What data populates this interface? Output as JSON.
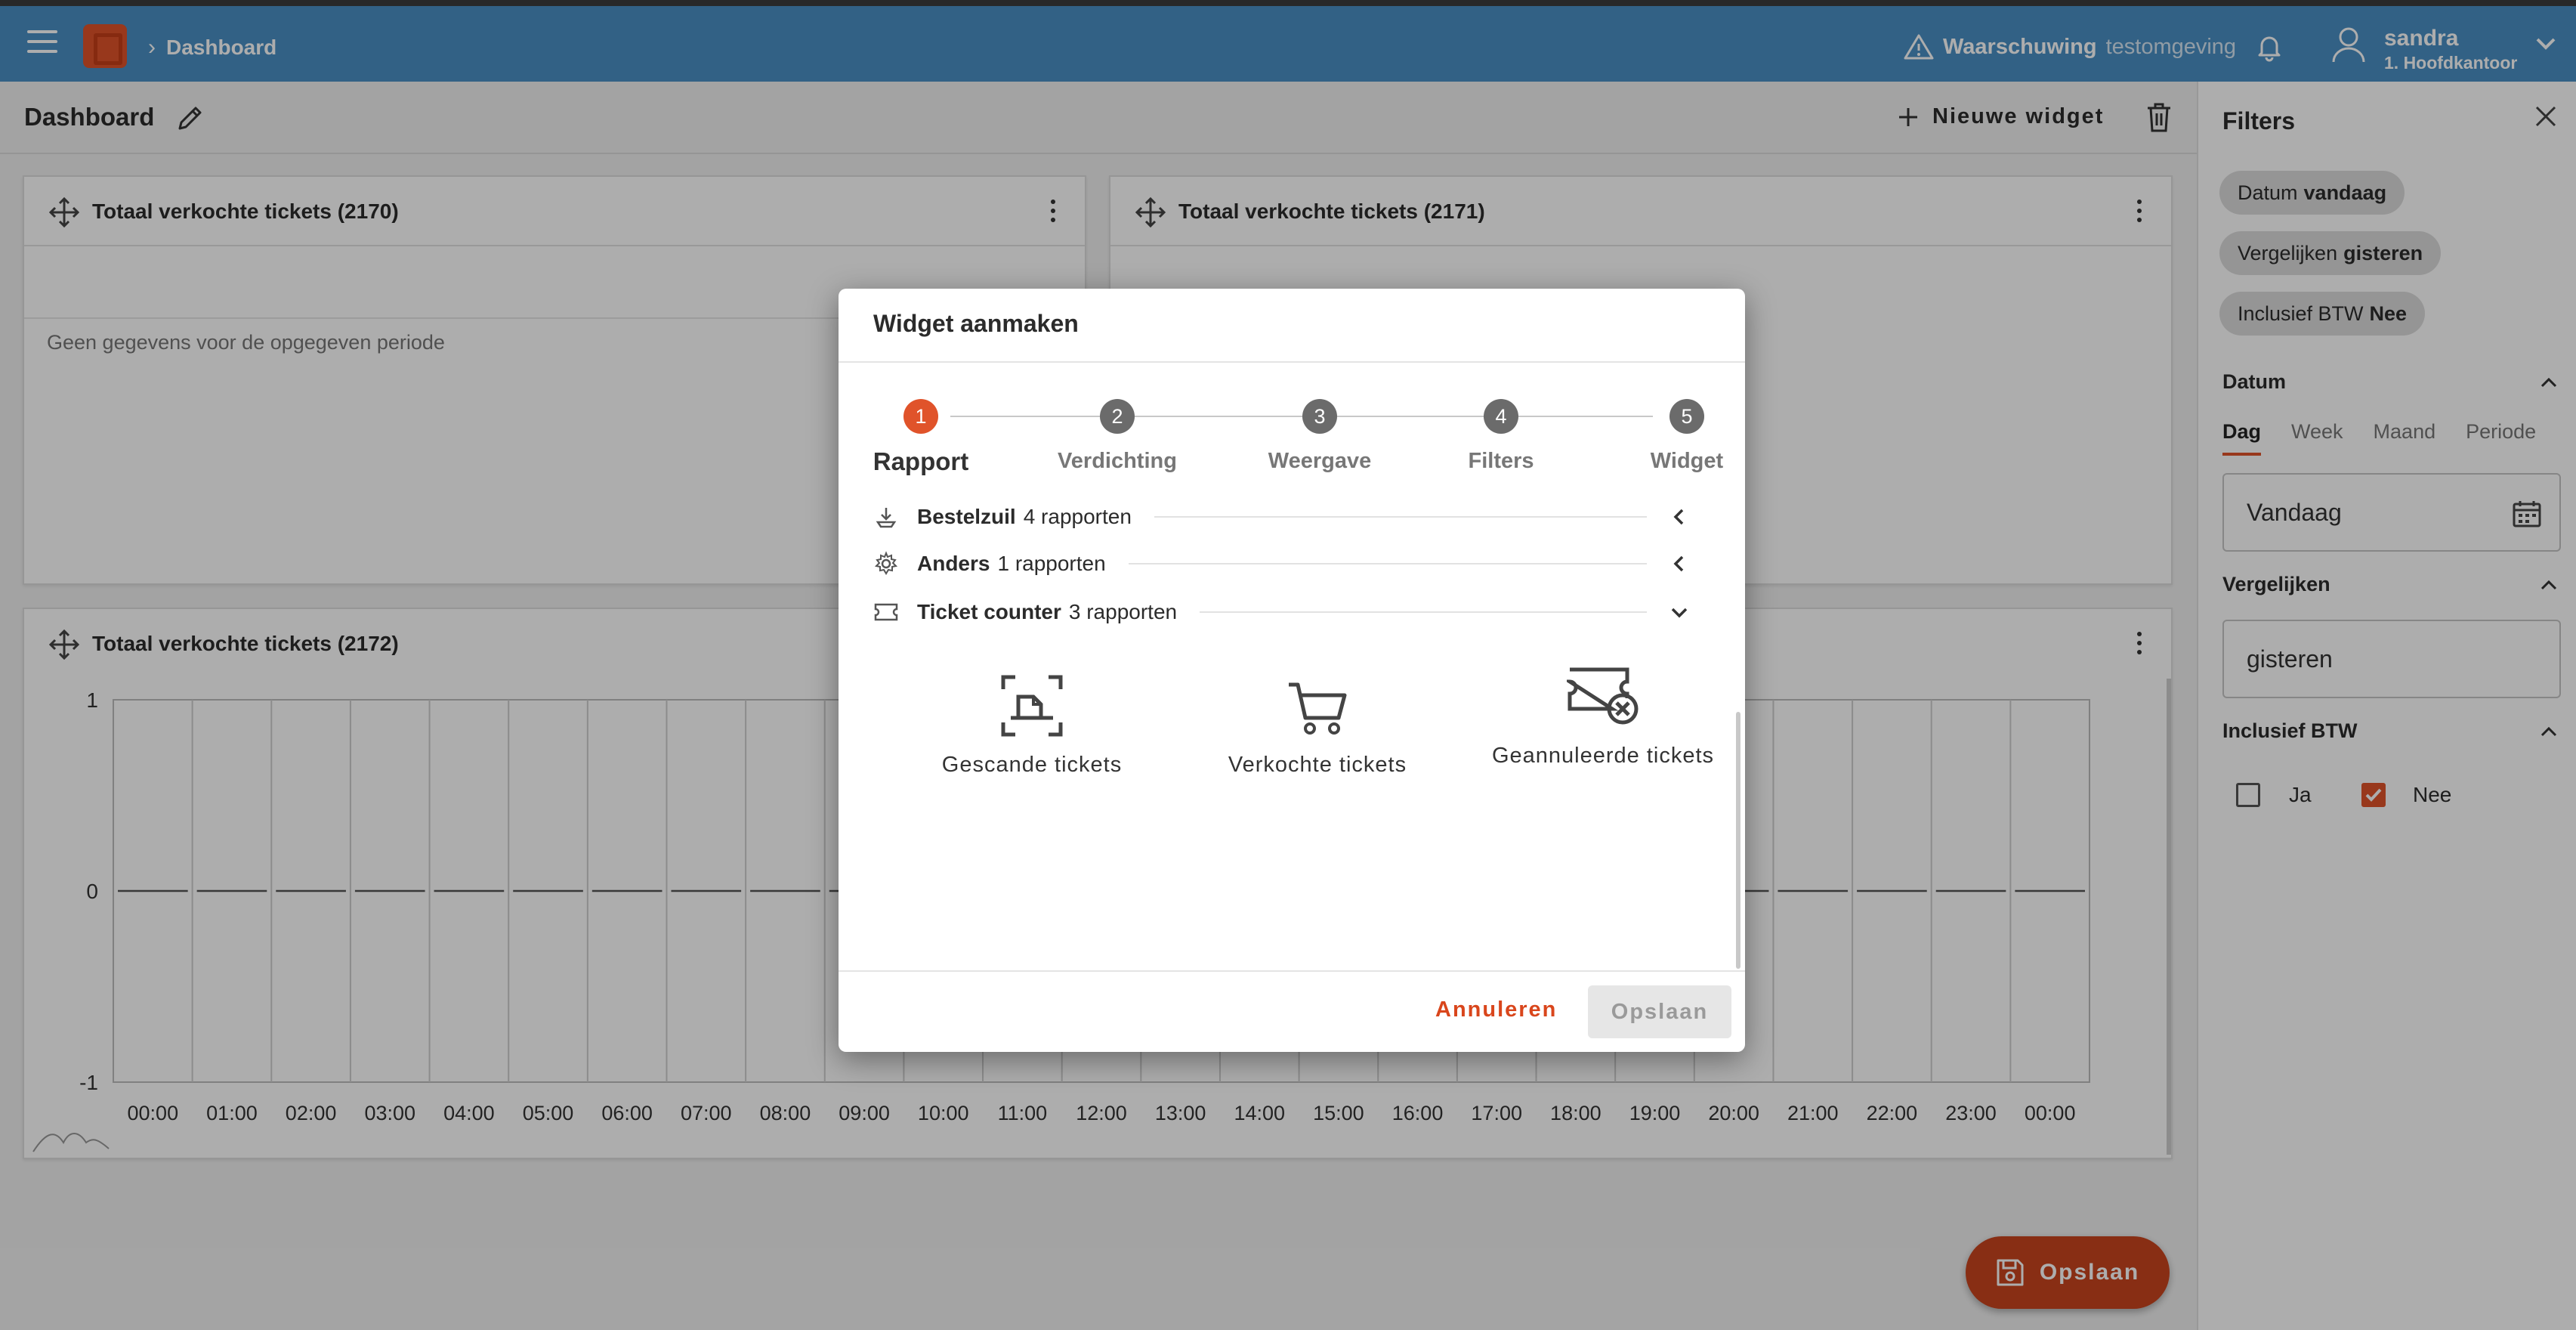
{
  "header": {
    "breadcrumb": "Dashboard",
    "warning_bold": "Waarschuwing",
    "warning_sub": "testomgeving",
    "user_name": "sandra",
    "user_org": "1. Hoofdkantoor",
    "brand_color": "#4a90c4",
    "accent_color": "#e0532a"
  },
  "toolbar": {
    "page_title": "Dashboard",
    "new_widget_label": "Nieuwe widget"
  },
  "widgets": [
    {
      "title": "Totaal verkochte tickets (2170)",
      "empty_text": "Geen gegevens voor de opgegeven periode"
    },
    {
      "title": "Totaal verkochte tickets (2171)"
    },
    {
      "title": "Totaal verkochte tickets (2172)"
    }
  ],
  "chart_data": {
    "type": "line",
    "categories": [
      "00:00",
      "01:00",
      "02:00",
      "03:00",
      "04:00",
      "05:00",
      "06:00",
      "07:00",
      "08:00",
      "09:00",
      "10:00",
      "11:00",
      "12:00",
      "13:00",
      "14:00",
      "15:00",
      "16:00",
      "17:00",
      "18:00",
      "19:00",
      "20:00",
      "21:00",
      "22:00",
      "23:00",
      "00:00"
    ],
    "values": [
      0,
      0,
      0,
      0,
      0,
      0,
      0,
      0,
      0,
      0,
      0,
      0,
      0,
      0,
      0,
      0,
      0,
      0,
      0,
      0,
      0,
      0,
      0,
      0,
      0
    ],
    "y_ticks": [
      "1",
      "0",
      "-1"
    ],
    "ylim": [
      -1,
      1
    ],
    "grid": true
  },
  "filters": {
    "title": "Filters",
    "chips": [
      {
        "label": "Datum",
        "value": "vandaag"
      },
      {
        "label": "Vergelijken",
        "value": "gisteren"
      },
      {
        "label": "Inclusief BTW",
        "value": "Nee"
      }
    ],
    "datum_title": "Datum",
    "tabs": [
      "Dag",
      "Week",
      "Maand",
      "Periode"
    ],
    "date_value": "Vandaag",
    "compare_title": "Vergelijken",
    "compare_value": "gisteren",
    "vat_title": "Inclusief BTW",
    "vat_yes": "Ja",
    "vat_no": "Nee"
  },
  "fab": {
    "label": "Opslaan"
  },
  "dialog": {
    "title": "Widget aanmaken",
    "steps": [
      {
        "num": "1",
        "label": "Rapport"
      },
      {
        "num": "2",
        "label": "Verdichting"
      },
      {
        "num": "3",
        "label": "Weergave"
      },
      {
        "num": "4",
        "label": "Filters"
      },
      {
        "num": "5",
        "label": "Widget"
      }
    ],
    "categories": [
      {
        "name": "Bestelzuil",
        "count": "4 rapporten"
      },
      {
        "name": "Anders",
        "count": "1 rapporten"
      },
      {
        "name": "Ticket counter",
        "count": "3 rapporten"
      }
    ],
    "reports": [
      "Gescande tickets",
      "Verkochte tickets",
      "Geannuleerde tickets"
    ],
    "cancel_label": "Annuleren",
    "save_label": "Opslaan"
  }
}
